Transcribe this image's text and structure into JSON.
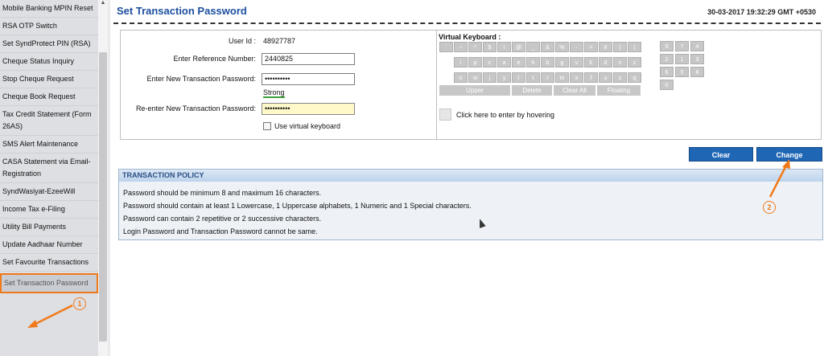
{
  "sidebar": {
    "items": [
      {
        "label": "Mobile Banking MPIN Reset"
      },
      {
        "label": "RSA OTP Switch"
      },
      {
        "label": "Set SyndProtect PIN (RSA)"
      },
      {
        "label": "Cheque Status Inquiry"
      },
      {
        "label": "Stop Cheque Request"
      },
      {
        "label": "Cheque Book Request"
      },
      {
        "label": "Tax Credit Statement (Form 26AS)"
      },
      {
        "label": "SMS Alert Maintenance"
      },
      {
        "label": "CASA Statement via Email- Registration"
      },
      {
        "label": "SyndWasiyat-EzeeWill"
      },
      {
        "label": "Income Tax e-Filing"
      },
      {
        "label": "Utility Bill Payments"
      },
      {
        "label": "Update Aadhaar Number"
      },
      {
        "label": "Set Favourite Transactions"
      },
      {
        "label": "Set Transaction Password"
      }
    ]
  },
  "page": {
    "title": "Set Transaction Password",
    "datetime": "30-03-2017 19:32:29 GMT +0530"
  },
  "form": {
    "user_id_label": "User Id :",
    "user_id_value": "48927787",
    "ref_label": "Enter Reference Number:",
    "ref_value": "2440825",
    "new_pwd_label": "Enter New Transaction Password:",
    "new_pwd_value": "••••••••••",
    "strength": "Strong",
    "reenter_label": "Re-enter New Transaction Password:",
    "reenter_value": "••••••••••",
    "vk_checkbox_label": "Use virtual keyboard"
  },
  "keyboard": {
    "title": "Virtual Keyboard :",
    "row1": [
      "`",
      "~",
      "^",
      "$",
      "!",
      "@",
      "_",
      "&",
      "%",
      "-",
      "=",
      "#",
      "|",
      "("
    ],
    "row2": [
      "i",
      "p",
      "c",
      "a",
      "e",
      "h",
      "b",
      "g",
      "v",
      "k",
      "d",
      "n",
      "z"
    ],
    "row3": [
      "o",
      "w",
      "j",
      "y",
      "l",
      "t",
      "r",
      "m",
      "x",
      "f",
      "u",
      "s",
      "q"
    ],
    "numbers": [
      "9",
      "7",
      "4",
      "2",
      "1",
      "3",
      "6",
      "5",
      "8",
      "0"
    ],
    "fn": {
      "upper": "Upper",
      "delete": "Delete",
      "clear_all": "Clear All",
      "floating": "Floating"
    },
    "hover_label": "Click here to enter by hovering"
  },
  "buttons": {
    "clear": "Clear",
    "change": "Change"
  },
  "policy": {
    "header": "TRANSACTION POLICY",
    "lines": [
      "Password should be minimum 8 and maximum 16 characters.",
      "Password should contain at least 1 Lowercase, 1 Uppercase alphabets, 1 Numeric and 1 Special characters.",
      "Password can contain 2 repetitive or 2 successive characters.",
      "Login Password and Transaction Password cannot be same."
    ]
  },
  "annotations": {
    "one": "1",
    "two": "2"
  },
  "colors": {
    "accent": "#1f66b5",
    "annotation": "#f07a1a",
    "title": "#1d4fa0"
  }
}
